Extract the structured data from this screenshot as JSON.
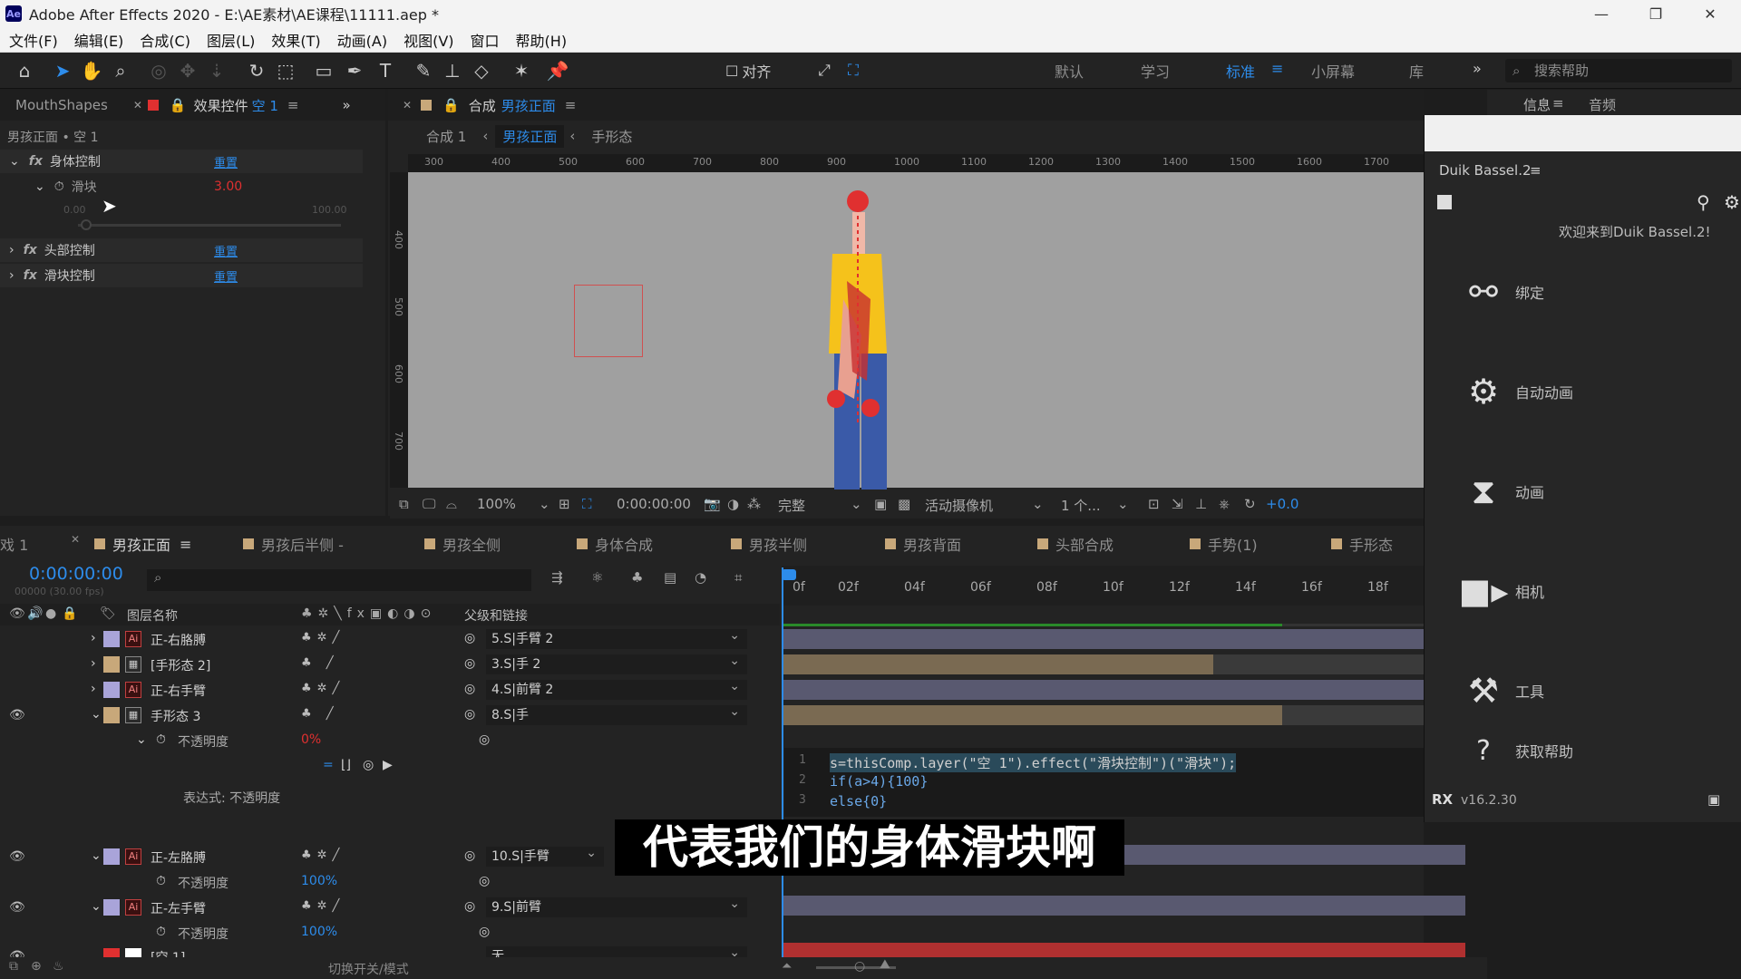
{
  "window": {
    "title": "Adobe After Effects 2020 - E:\\AE素材\\AE课程\\11111.aep *",
    "logo": "Ae",
    "minimize": "—",
    "maximize": "❐",
    "close": "✕"
  },
  "menu": [
    "文件(F)",
    "编辑(E)",
    "合成(C)",
    "图层(L)",
    "效果(T)",
    "动画(A)",
    "视图(V)",
    "窗口",
    "帮助(H)"
  ],
  "toolbar": {
    "align_label": "对齐",
    "workspaces": [
      "默认",
      "学习",
      "标准",
      "小屏幕",
      "库"
    ],
    "active_workspace": "标准",
    "search_placeholder": "搜索帮助"
  },
  "effects_panel": {
    "tab_mouth": "MouthShapes",
    "tab_effects": "效果控件",
    "tab_effects_target": "空 1",
    "breadcrumb": "男孩正面 • 空 1",
    "effects": [
      {
        "name": "身体控制",
        "reset": "重置"
      },
      {
        "name": "头部控制",
        "reset": "重置"
      },
      {
        "name": "滑块控制",
        "reset": "重置"
      }
    ],
    "slider_label": "滑块",
    "slider_value": "3.00",
    "slider_min": "0.00",
    "slider_max": "100.00",
    "slider_fraction": 0.03
  },
  "comp_panel": {
    "tab_prefix": "合成",
    "tab_comp": "男孩正面",
    "crumbs": [
      "合成 1",
      "男孩正面",
      "手形态"
    ],
    "ruler_h": [
      "300",
      "400",
      "500",
      "600",
      "700",
      "800",
      "900",
      "1000",
      "1100",
      "1200",
      "1300",
      "1400",
      "1500",
      "1600",
      "1700"
    ],
    "ruler_v": [
      "400",
      "500",
      "600",
      "700"
    ],
    "zoom": "100%",
    "timecode": "0:00:00:00",
    "quality": "完整",
    "camera": "活动摄像机",
    "views": "1 个...",
    "exposure": "+0.0"
  },
  "right_panel": {
    "tab_info": "信息",
    "tab_audio": "音频",
    "duik_title": "Duik Bassel.2",
    "welcome": "欢迎来到Duik Bassel.2!",
    "items": [
      {
        "label": "绑定",
        "icon": "bone-icon"
      },
      {
        "label": "自动动画",
        "icon": "gear-icon"
      },
      {
        "label": "动画",
        "icon": "hourglass-icon"
      },
      {
        "label": "相机",
        "icon": "camera-icon"
      },
      {
        "label": "工具",
        "icon": "tools-icon"
      },
      {
        "label": "获取帮助",
        "icon": "help-icon"
      }
    ],
    "version": "v16.2.30"
  },
  "timeline": {
    "tabs": [
      "戏 1",
      "男孩正面",
      "男孩后半侧 -",
      "男孩全侧",
      "身体合成",
      "男孩半侧",
      "男孩背面",
      "头部合成",
      "手势(1)",
      "手形态"
    ],
    "timecode": "0:00:00:00",
    "frame_info": "00000 (30.00 fps)",
    "col_layer_name": "图层名称",
    "col_parent": "父级和链接",
    "ticks": [
      "0f",
      "02f",
      "04f",
      "06f",
      "08f",
      "10f",
      "12f",
      "14f",
      "16f",
      "18f"
    ],
    "layers": [
      {
        "name": "正-右胳膊",
        "parent": "5.S|手臂 2"
      },
      {
        "name": "[手形态 2]",
        "parent": "3.S|手 2"
      },
      {
        "name": "正-右手臂",
        "parent": "4.S|前臂 2"
      },
      {
        "name": "手形态 3",
        "parent": "8.S|手"
      },
      {
        "name": "正-左胳膊",
        "parent": "10.S|手臂"
      },
      {
        "name": "正-左手臂",
        "parent": "9.S|前臂"
      },
      {
        "name": "[空 1]",
        "parent": "无"
      }
    ],
    "opacity_label": "不透明度",
    "opacity_values": [
      "0%",
      "100%",
      "100%"
    ],
    "expression_label": "表达式: 不透明度",
    "code": [
      "s=thisComp.layer(\"空 1\").effect(\"滑块控制\")(\"滑块\");",
      "if(a>4){100}",
      "else{0}"
    ],
    "line_numbers": [
      "1",
      "2",
      "3"
    ],
    "toggle_label": "切换开关/模式"
  },
  "subtitle": "代表我们的身体滑块啊",
  "colors": {
    "accent": "#2d8ceb",
    "label_lavender": "#a9a4d9",
    "label_tan": "#c8a87a",
    "label_red": "#e03030"
  }
}
